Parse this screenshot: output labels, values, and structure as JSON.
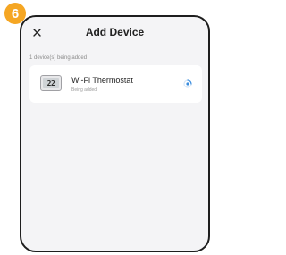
{
  "step_badge": "6",
  "header": {
    "title": "Add Device",
    "close_icon": "close-icon"
  },
  "status": {
    "text": "1 device(s) being added"
  },
  "device": {
    "icon": "thermostat-icon",
    "screen_reading": "22",
    "name": "Wi-Fi Thermostat",
    "status": "Being added",
    "progress_icon": "loading-spinner-icon"
  },
  "colors": {
    "badge": "#f5a623",
    "spinner": "#3a8dde",
    "background": "#f4f4f6"
  }
}
